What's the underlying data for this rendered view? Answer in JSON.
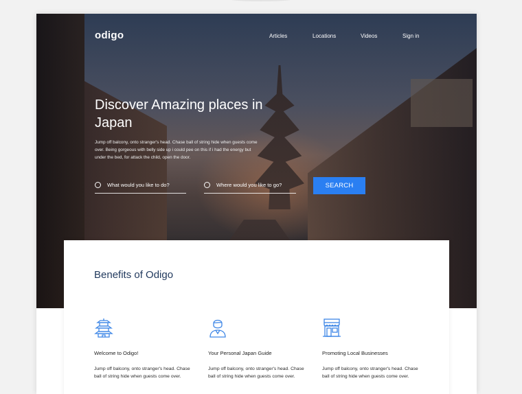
{
  "brand": {
    "logo": "odigo"
  },
  "nav": {
    "items": [
      {
        "label": "Articles"
      },
      {
        "label": "Locations"
      },
      {
        "label": "Videos"
      },
      {
        "label": "Sign in"
      }
    ]
  },
  "hero": {
    "headline_line1": "Discover Amazing places in",
    "headline_line2": "Japan",
    "lede": "Jump off balcony, onto stranger's head. Chase ball of string hide when guests come over. Being gorgeous with belly side up i could pee on this if i had the energy but under the bed, for attack the child, open the door.",
    "search": {
      "what_placeholder": "What would you like to do?",
      "where_placeholder": "Where would you like to go?",
      "button_label": "SEARCH"
    }
  },
  "benefits": {
    "title": "Benefits of Odigo",
    "accent_color": "#3d86e6",
    "items": [
      {
        "icon": "pagoda-icon",
        "title": "Welcome to Odigo!",
        "text": "Jump off balcony, onto stranger's head. Chase ball of string hide when guests come over."
      },
      {
        "icon": "guide-person-icon",
        "title": "Your Personal Japan Guide",
        "text": "Jump off balcony, onto stranger's head. Chase ball of string hide when guests come over."
      },
      {
        "icon": "storefront-icon",
        "title": "Promoting Local Businesses",
        "text": "Jump off balcony, onto stranger's head. Chase ball of string hide when guests come over."
      }
    ]
  }
}
